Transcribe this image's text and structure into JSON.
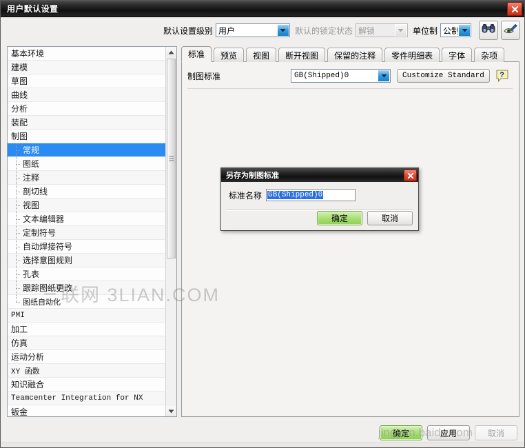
{
  "window": {
    "title": "用户默认设置",
    "close_icon": "close-icon"
  },
  "toolbar": {
    "level_label": "默认设置级别",
    "level_value": "用户",
    "lock_label": "默认的锁定状态",
    "lock_value": "解锁",
    "units_label": "单位制",
    "units_value": "公制",
    "find_icon": "binoculars-icon",
    "manage_icon": "eye-pencil-icon"
  },
  "tree": {
    "items": [
      {
        "label": "基本环境",
        "level": 0,
        "selected": false,
        "mono": false
      },
      {
        "label": "建模",
        "level": 0,
        "selected": false,
        "mono": false
      },
      {
        "label": "草图",
        "level": 0,
        "selected": false,
        "mono": false
      },
      {
        "label": "曲线",
        "level": 0,
        "selected": false,
        "mono": false
      },
      {
        "label": "分析",
        "level": 0,
        "selected": false,
        "mono": false
      },
      {
        "label": "装配",
        "level": 0,
        "selected": false,
        "mono": false
      },
      {
        "label": "制图",
        "level": 0,
        "selected": false,
        "mono": false
      },
      {
        "label": "常规",
        "level": 1,
        "selected": true,
        "mono": false
      },
      {
        "label": "图纸",
        "level": 1,
        "selected": false,
        "mono": false
      },
      {
        "label": "注释",
        "level": 1,
        "selected": false,
        "mono": false
      },
      {
        "label": "剖切线",
        "level": 1,
        "selected": false,
        "mono": false
      },
      {
        "label": "视图",
        "level": 1,
        "selected": false,
        "mono": false
      },
      {
        "label": "文本编辑器",
        "level": 1,
        "selected": false,
        "mono": false
      },
      {
        "label": "定制符号",
        "level": 1,
        "selected": false,
        "mono": false
      },
      {
        "label": "自动焊接符号",
        "level": 1,
        "selected": false,
        "mono": false
      },
      {
        "label": "选择意图规则",
        "level": 1,
        "selected": false,
        "mono": false
      },
      {
        "label": "孔表",
        "level": 1,
        "selected": false,
        "mono": false
      },
      {
        "label": "跟踪图纸更改",
        "level": 1,
        "selected": false,
        "mono": false
      },
      {
        "label": "图纸自动化",
        "level": 1,
        "selected": false,
        "mono": true,
        "last": true
      },
      {
        "label": "PMI",
        "level": 0,
        "selected": false,
        "mono": true
      },
      {
        "label": "加工",
        "level": 0,
        "selected": false,
        "mono": false
      },
      {
        "label": "仿真",
        "level": 0,
        "selected": false,
        "mono": false
      },
      {
        "label": "运动分析",
        "level": 0,
        "selected": false,
        "mono": false
      },
      {
        "label": "XY 函数",
        "level": 0,
        "selected": false,
        "mono": true
      },
      {
        "label": "知识融合",
        "level": 0,
        "selected": false,
        "mono": false
      },
      {
        "label": "Teamcenter Integration for NX",
        "level": 0,
        "selected": false,
        "mono": true
      },
      {
        "label": "钣金",
        "level": 0,
        "selected": false,
        "mono": false
      }
    ],
    "scroll_up_icon": "scroll-up-arrow-icon",
    "scroll_down_icon": "scroll-down-arrow-icon"
  },
  "tabs": [
    {
      "label": "标准",
      "active": true
    },
    {
      "label": "预览",
      "active": false
    },
    {
      "label": "视图",
      "active": false
    },
    {
      "label": "断开视图",
      "active": false
    },
    {
      "label": "保留的注释",
      "active": false
    },
    {
      "label": "零件明细表",
      "active": false
    },
    {
      "label": "字体",
      "active": false
    },
    {
      "label": "杂项",
      "active": false
    }
  ],
  "standard_panel": {
    "label": "制图标准",
    "value": "GB(Shipped)0",
    "customize_button": "Customize Standard",
    "help_icon": "help-question-icon"
  },
  "dialog": {
    "title": "另存为制图标准",
    "close_icon": "close-icon",
    "field_label": "标准名称",
    "field_value": "GB(Shipped)0",
    "ok_label": "确定",
    "cancel_label": "取消"
  },
  "footer": {
    "ok_label": "确定",
    "apply_label": "应用",
    "cancel_label": "取消"
  },
  "watermarks": {
    "main": "三联网 3LIAN.COM",
    "bottom": "jingyan.baidu.com"
  },
  "colors": {
    "selection_blue": "#2a8bf2",
    "primary_green": "#8bcf52",
    "close_red": "#e04f36",
    "combo_arrow_blue": "#3a9fe0"
  }
}
